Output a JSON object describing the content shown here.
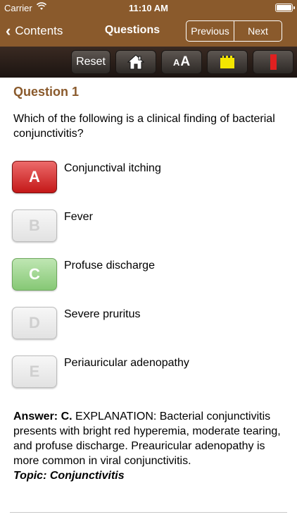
{
  "status": {
    "carrier": "Carrier",
    "time": "11:10 AM"
  },
  "nav": {
    "back_label": "Contents",
    "title": "Questions",
    "previous_label": "Previous",
    "next_label": "Next"
  },
  "toolbar": {
    "reset_label": "Reset",
    "font_label_small": "A",
    "font_label_large": "A"
  },
  "question": {
    "title": "Question 1",
    "text": "Which of the following is a clinical finding of bacterial conjunctivitis?",
    "choices": [
      {
        "letter": "A",
        "text": "Conjunctival itching",
        "state": "wrong"
      },
      {
        "letter": "B",
        "text": "Fever",
        "state": "none"
      },
      {
        "letter": "C",
        "text": "Profuse discharge",
        "state": "correct"
      },
      {
        "letter": "D",
        "text": "Severe pruritus",
        "state": "none"
      },
      {
        "letter": "E",
        "text": "Periauricular adenopathy",
        "state": "none"
      }
    ]
  },
  "answer": {
    "prefix": "Answer: C.",
    "text": " EXPLANATION: Bacterial conjunctivitis presents with bright red hyperemia, moderate tearing, and profuse discharge. Preauricular adenopathy is more common in viral conjunctivitis.",
    "topic_label": "Topic:",
    "topic": "Conjunctivitis"
  },
  "colors": {
    "brand": "#8a5a2c",
    "wrong": "#d22a2a",
    "correct": "#8fce7e"
  }
}
